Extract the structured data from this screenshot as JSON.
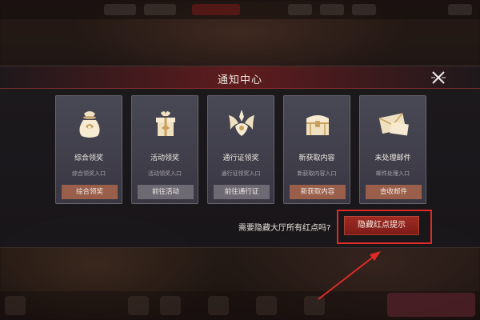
{
  "dialog": {
    "title": "通知中心"
  },
  "cards": [
    {
      "icon": "fortune-bag-icon",
      "title": "综合领奖",
      "subtitle": "综合领奖入口",
      "button": "综合领奖",
      "accent": true
    },
    {
      "icon": "gift-box-icon",
      "title": "活动领奖",
      "subtitle": "活动领奖入口",
      "button": "前往活动",
      "accent": false
    },
    {
      "icon": "pass-emblem-icon",
      "title": "通行证领奖",
      "subtitle": "通行证领奖入口",
      "button": "前往通行证",
      "accent": false
    },
    {
      "icon": "treasure-chest-icon",
      "title": "新获取内容",
      "subtitle": "新获取内容入口",
      "button": "新获取内容",
      "accent": true
    },
    {
      "icon": "mail-envelope-icon",
      "title": "未处理邮件",
      "subtitle": "邮件处理入口",
      "button": "查收邮件",
      "accent": true
    }
  ],
  "footer": {
    "question": "需要隐藏大厅所有红点吗?",
    "hide_button": "隐藏红点提示"
  },
  "colors": {
    "accent_button": "#9a5f4a",
    "neutral_button": "#6e6a74",
    "hide_button": "#a02b22",
    "highlight": "#e02a25"
  }
}
